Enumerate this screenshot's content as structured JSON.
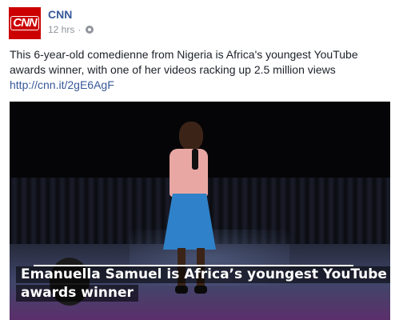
{
  "header": {
    "page_name": "CNN",
    "avatar_text": "CNN",
    "timestamp": "12 hrs",
    "separator": "·",
    "audience_icon": "globe-icon"
  },
  "post": {
    "text": "This 6-year-old comedienne from Nigeria is Africa's youngest YouTube awards winner, with one of her videos racking up 2.5 million views",
    "link": "http://cnn.it/2gE6AgF"
  },
  "video": {
    "caption_line1": "Emanuella Samuel is Africa’s youngest YouTube",
    "caption_line2": "awards winner"
  },
  "colors": {
    "brand_red": "#cc0000",
    "link_blue": "#365899",
    "meta_gray": "#90949c"
  }
}
